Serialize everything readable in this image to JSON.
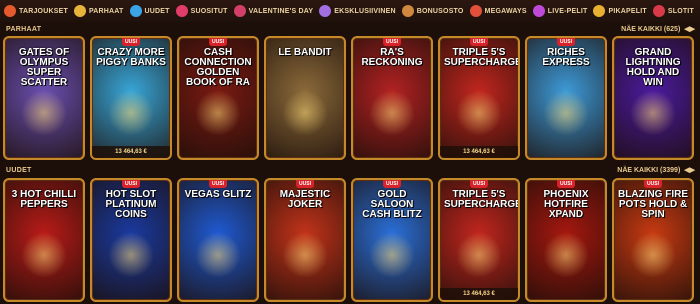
{
  "nav": [
    {
      "label": "TARJOUKSET",
      "icon": "gift-icon",
      "color": "#e35a2f"
    },
    {
      "label": "PARHAAT",
      "icon": "star-icon",
      "color": "#e6b43a"
    },
    {
      "label": "UUDET",
      "icon": "new-icon",
      "color": "#3aa5e6"
    },
    {
      "label": "SUOSITUT",
      "icon": "heart-icon",
      "color": "#e23d6a"
    },
    {
      "label": "VALENTINE'S DAY",
      "icon": "rose-icon",
      "color": "#d2406a"
    },
    {
      "label": "EKSKLUSIIVINEN",
      "icon": "diamond-icon",
      "color": "#a36ee0"
    },
    {
      "label": "BONUSOSTO",
      "icon": "bag-icon",
      "color": "#d08840"
    },
    {
      "label": "MEGAWAYS",
      "icon": "slot-icon",
      "color": "#e0503a"
    },
    {
      "label": "LIVE-PELIT",
      "icon": "live-icon",
      "color": "#c04ad8"
    },
    {
      "label": "PIKAPELIT",
      "icon": "lightning-icon",
      "color": "#e8b030"
    },
    {
      "label": "SLOTIT",
      "icon": "cherry-icon",
      "color": "#d83a4a"
    }
  ],
  "sections": [
    {
      "title": "PARHAAT",
      "see_all": "NÄE KAIKKI (625)",
      "cards": [
        {
          "title": "GATES OF OLYMPUS SUPER SCATTER",
          "bg": "#6a4fb0",
          "badge": "",
          "jackpot": ""
        },
        {
          "title": "CRAZY MORE PIGGY BANKS",
          "bg": "#38a6d8",
          "badge": "UUSI",
          "jackpot": "13 464,63 €"
        },
        {
          "title": "CASH CONNECTION GOLDEN BOOK OF RA",
          "bg": "#7a1a12",
          "badge": "UUSI",
          "jackpot": ""
        },
        {
          "title": "LE BANDIT",
          "bg": "#8b6a3a",
          "badge": "",
          "jackpot": ""
        },
        {
          "title": "RA'S RECKONING",
          "bg": "#b22222",
          "badge": "UUSI",
          "jackpot": ""
        },
        {
          "title": "TRIPLE 5'S SUPERCHARGE",
          "bg": "#c0261e",
          "badge": "UUSI",
          "jackpot": "13 464,63 €"
        },
        {
          "title": "RICHES EXPRESS",
          "bg": "#3d9ad8",
          "badge": "UUSI",
          "jackpot": ""
        },
        {
          "title": "GRAND LIGHTNING HOLD AND WIN",
          "bg": "#4b1a9e",
          "badge": "",
          "jackpot": ""
        }
      ]
    },
    {
      "title": "UUDET",
      "see_all": "NÄE KAIKKI (3399)",
      "cards": [
        {
          "title": "3 HOT CHILLI PEPPERS",
          "bg": "#b81b18",
          "badge": "",
          "jackpot": ""
        },
        {
          "title": "HOT SLOT PLATINUM COINS",
          "bg": "#1a3aa0",
          "badge": "UUSI",
          "jackpot": ""
        },
        {
          "title": "VEGAS GLITZ",
          "bg": "#1f5ad2",
          "badge": "UUSI",
          "jackpot": ""
        },
        {
          "title": "MAJESTIC JOKER",
          "bg": "#c2331a",
          "badge": "UUSI",
          "jackpot": ""
        },
        {
          "title": "GOLD SALOON CASH BLITZ",
          "bg": "#2a6fd8",
          "badge": "UUSI",
          "jackpot": ""
        },
        {
          "title": "TRIPLE 5'S SUPERCHARGE",
          "bg": "#c0261e",
          "badge": "UUSI",
          "jackpot": "13 464,63 €"
        },
        {
          "title": "PHOENIX HOTFIRE XPAND",
          "bg": "#a5180f",
          "badge": "UUSI",
          "jackpot": ""
        },
        {
          "title": "BLAZING FIRE POTS HOLD & SPIN",
          "bg": "#c73a12",
          "badge": "UUSI",
          "jackpot": ""
        }
      ]
    }
  ]
}
